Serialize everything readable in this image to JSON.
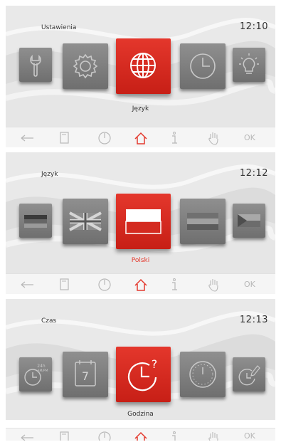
{
  "screens": [
    {
      "title": "Ustawienia",
      "time": "12:10",
      "selected_label": "Język",
      "selected_label_color": "#333333",
      "tiles": [
        "wrench-icon",
        "gear-icon",
        "globe-icon",
        "clock-icon",
        "lightbulb-icon"
      ]
    },
    {
      "title": "Język",
      "time": "12:12",
      "selected_label": "Polski",
      "selected_label_color": "#e43a2e",
      "tiles": [
        "flag-germany-icon",
        "flag-uk-icon",
        "flag-poland-icon",
        "flag-hungary-icon",
        "flag-czech-icon"
      ]
    },
    {
      "title": "Czas",
      "time": "12:13",
      "selected_label": "Godzina",
      "selected_label_color": "#333333",
      "tiles": [
        "clock-24h-icon",
        "calendar-7-icon",
        "clock-question-icon",
        "clock-dial-icon",
        "clock-edit-icon"
      ],
      "tile_text": {
        "calendar_day": "7",
        "h24_top": "24h",
        "h24_bottom": "AM/PM"
      }
    }
  ],
  "navbar": {
    "ok_label": "OK",
    "items": [
      "back-arrow-icon",
      "book-icon",
      "power-icon",
      "home-icon",
      "info-icon",
      "hand-icon"
    ]
  },
  "colors": {
    "accent": "#e43a2e",
    "tile": "#7f7f7f",
    "nav_icon": "#b8b8b8"
  }
}
